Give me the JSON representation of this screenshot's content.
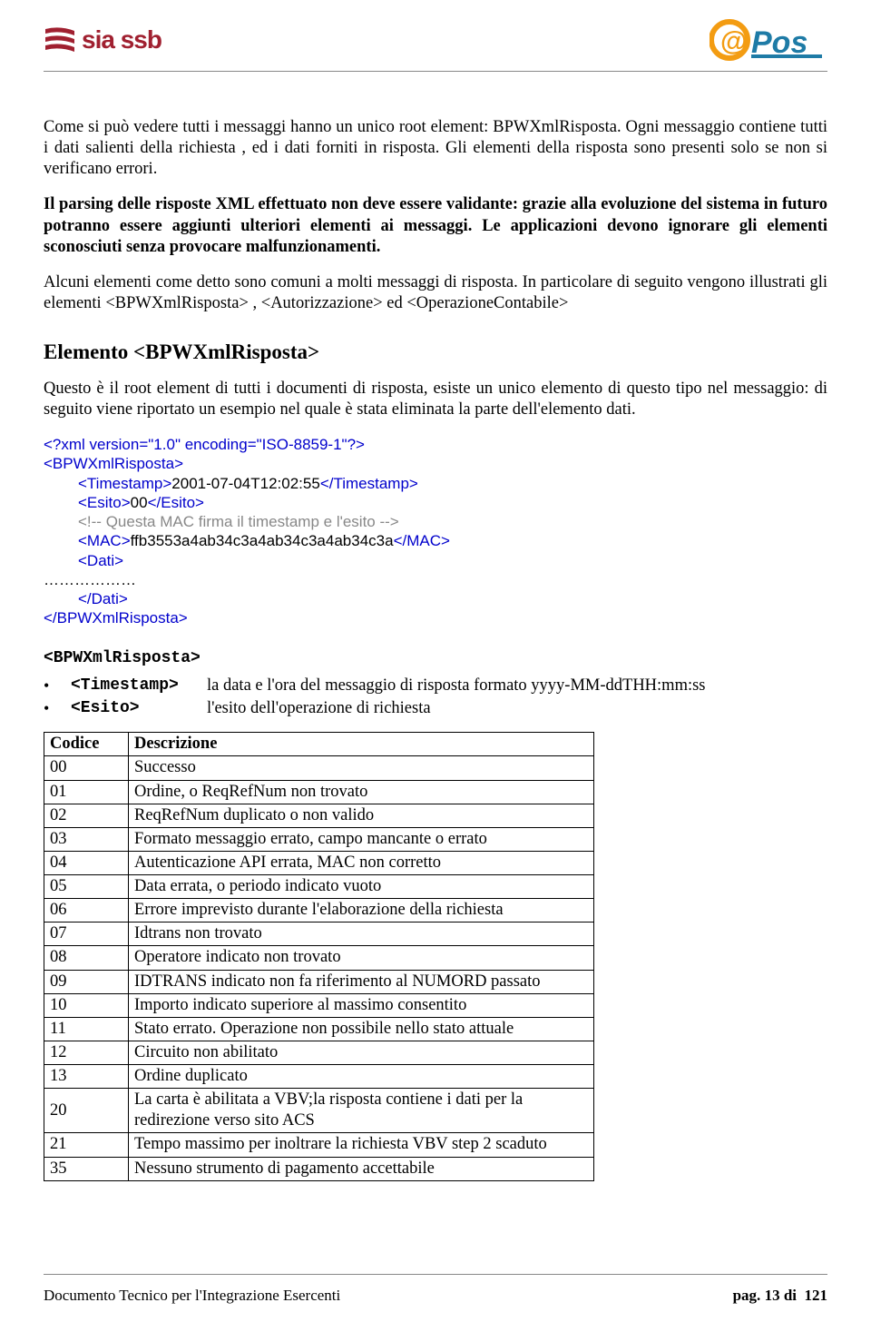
{
  "header": {
    "logo_left_text": "sia ssb",
    "logo_right_at": "@",
    "logo_right_pos": "Pos"
  },
  "para1": "Come si può vedere tutti i messaggi hanno un unico root element: BPWXmlRisposta. Ogni messaggio contiene tutti i dati salienti della richiesta , ed i dati forniti in risposta. Gli elementi della risposta sono presenti solo se non si verificano errori.",
  "para2": "Il parsing delle risposte XML effettuato non deve essere validante: grazie alla evoluzione del sistema in futuro potranno essere aggiunti ulteriori elementi ai messaggi. Le applicazioni devono ignorare gli elementi sconosciuti senza provocare malfunzionamenti.",
  "para3": "Alcuni elementi come detto sono comuni a molti messaggi di risposta. In particolare di seguito vengono illustrati gli elementi <BPWXmlRisposta> , <Autorizzazione> ed <OperazioneContabile>",
  "h2": "Elemento <BPWXmlRisposta>",
  "para4": "Questo è il root element di tutti i documenti di risposta, esiste un unico elemento di questo tipo nel messaggio: di seguito viene riportato un esempio nel quale è stata eliminata la parte dell'elemento dati.",
  "xml": {
    "decl": "<?xml version=\"1.0\" encoding=\"ISO-8859-1\"?>",
    "open": "<BPWXmlRisposta>",
    "ts_open": "<Timestamp>",
    "ts_val": "2001-07-04T12:02:55",
    "ts_close": "</Timestamp>",
    "es_open": "<Esito>",
    "es_val": "00",
    "es_close": "</Esito>",
    "comment": "<!-- Questa MAC firma il timestamp e l'esito -->",
    "mac_open": "<MAC>",
    "mac_val": "ffb3553a4ab34c3a4ab34c3a4ab34c3a",
    "mac_close": "</MAC>",
    "dati_open": "<Dati>",
    "dots": "………………",
    "dati_close": "</Dati>",
    "close": "</BPWXmlRisposta>"
  },
  "elem_tag": "<BPWXmlRisposta>",
  "bullets": [
    {
      "tag": "<Timestamp>",
      "desc": "la data e l'ora del messaggio di risposta formato yyyy-MM-ddTHH:mm:ss"
    },
    {
      "tag": "<Esito>",
      "desc": "l'esito dell'operazione di richiesta"
    }
  ],
  "table": {
    "h_code": "Codice",
    "h_desc": "Descrizione",
    "rows": [
      {
        "c": "00",
        "d": "Successo"
      },
      {
        "c": "01",
        "d": "Ordine, o ReqRefNum non trovato"
      },
      {
        "c": "02",
        "d": "ReqRefNum duplicato o non valido"
      },
      {
        "c": "03",
        "d": "Formato messaggio errato, campo mancante o errato"
      },
      {
        "c": "04",
        "d": "Autenticazione API errata, MAC non corretto"
      },
      {
        "c": "05",
        "d": "Data errata, o periodo indicato vuoto"
      },
      {
        "c": "06",
        "d": "Errore imprevisto durante l'elaborazione della richiesta"
      },
      {
        "c": "07",
        "d": "Idtrans non trovato"
      },
      {
        "c": "08",
        "d": "Operatore indicato non trovato"
      },
      {
        "c": "09",
        "d": "IDTRANS indicato non fa riferimento al NUMORD passato"
      },
      {
        "c": "10",
        "d": "Importo indicato superiore al massimo consentito"
      },
      {
        "c": "11",
        "d": "Stato errato. Operazione non possibile nello stato attuale"
      },
      {
        "c": "12",
        "d": "Circuito non abilitato"
      },
      {
        "c": "13",
        "d": "Ordine duplicato"
      },
      {
        "c": "20",
        "d": "La carta è abilitata a VBV;la risposta contiene i dati per la redirezione verso sito ACS"
      },
      {
        "c": "21",
        "d": "Tempo massimo per inoltrare la richiesta VBV step 2 scaduto"
      },
      {
        "c": "35",
        "d": "Nessuno strumento di pagamento accettabile"
      }
    ]
  },
  "footer": {
    "left": "Documento Tecnico per l'Integrazione Esercenti",
    "right_pag": "pag.",
    "right_num": "13",
    "right_di": "di",
    "right_tot": "121"
  }
}
